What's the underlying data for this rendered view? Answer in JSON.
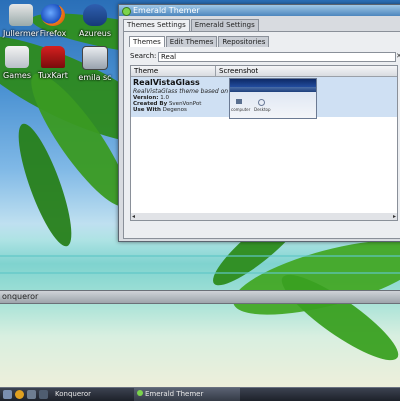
{
  "desktop": {
    "icons": [
      {
        "label": "Jullermer",
        "icon": "app-icon"
      },
      {
        "label": "Firefox",
        "icon": "firefox-icon"
      },
      {
        "label": "Azureus",
        "icon": "azureus-icon"
      },
      {
        "label": "Games",
        "icon": "games-icon"
      },
      {
        "label": "TuxKart",
        "icon": "tuxkart-icon"
      },
      {
        "label": "emila sc",
        "icon": "terminal-icon"
      }
    ]
  },
  "konqueror_bar": {
    "title": "onqueror"
  },
  "window": {
    "title": "Emerald Themer",
    "tabs": [
      "Themes Settings",
      "Emerald Settings"
    ],
    "subtabs": [
      "Themes",
      "Edit Themes",
      "Repositories"
    ],
    "search": {
      "label": "Search:",
      "value": "Real"
    },
    "list": {
      "columns": [
        "Theme",
        "Screenshot"
      ],
      "rows": [
        {
          "name": "RealVistaGlass",
          "description": "RealVistaGlass theme based on ...",
          "version_label": "Version:",
          "version": "1.0",
          "created_label": "Created By",
          "created": "SvenVonPot",
          "engine_label": "Use With",
          "engine": "Degenos",
          "shot_labels": [
            "computer",
            "Desktop"
          ]
        }
      ]
    }
  },
  "taskbar": {
    "items": [
      {
        "label": "Konqueror"
      },
      {
        "label": "Emerald Themer"
      }
    ]
  },
  "colors": {
    "selection": "#cfe0f3",
    "accent": "#4d86bd"
  }
}
